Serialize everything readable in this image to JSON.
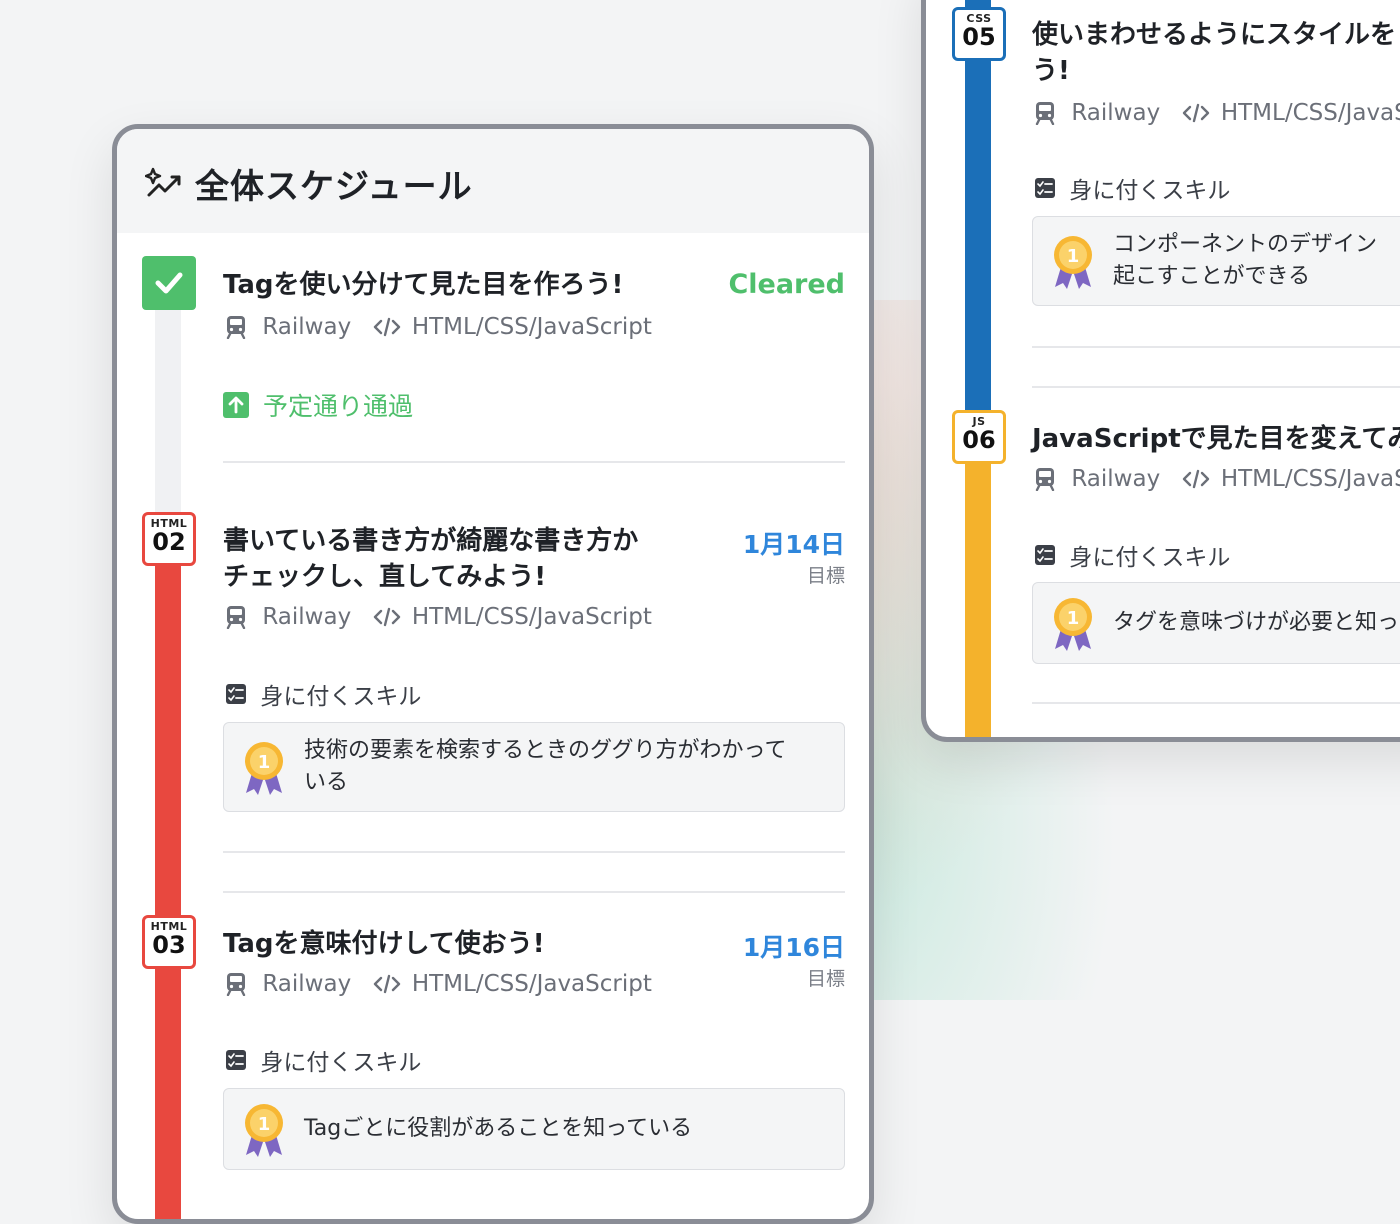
{
  "main": {
    "title": "全体スケジュール",
    "items": [
      {
        "title": "Tagを使い分けて見た目を作ろう!",
        "provider": "Railway",
        "tech": "HTML/CSS/JavaScript",
        "status": "Cleared",
        "passed": "予定通り通過"
      },
      {
        "category": "HTML",
        "number": "02",
        "title_line1": "書いている書き方が綺麗な書き方か",
        "title_line2": "チェックし、直してみよう!",
        "provider": "Railway",
        "tech": "HTML/CSS/JavaScript",
        "date": "1月14日",
        "date_label": "目標",
        "skills_label": "身に付くスキル",
        "skill_line1": "技術の要素を検索するときのググり方がわかって",
        "skill_line2": "いる"
      },
      {
        "category": "HTML",
        "number": "03",
        "title": "Tagを意味付けして使おう!",
        "provider": "Railway",
        "tech": "HTML/CSS/JavaScript",
        "date": "1月16日",
        "date_label": "目標",
        "skills_label": "身に付くスキル",
        "skill": "Tagごとに役割があることを知っている"
      }
    ]
  },
  "side": {
    "items": [
      {
        "category": "CSS",
        "number": "05",
        "title_line1": "使いまわせるようにスタイルを",
        "title_line2": "う!",
        "provider": "Railway",
        "tech": "HTML/CSS/JavaScr",
        "skills_label": "身に付くスキル",
        "skill_line1": "コンポーネントのデザイン",
        "skill_line2": "起こすことができる"
      },
      {
        "category": "JS",
        "number": "06",
        "title": "JavaScriptで見た目を変えてみ",
        "provider": "Railway",
        "tech": "HTML/CSS/JavaScr",
        "skills_label": "身に付くスキル",
        "skill": "タグを意味づけが必要と知っ"
      }
    ]
  },
  "colors": {
    "cleared": "#4fbf6c",
    "html": "#e8483f",
    "css": "#1b6fb8",
    "js": "#f4b22c",
    "date": "#2f86db"
  },
  "icons": [
    "sparkle-icon",
    "check-icon",
    "train-icon",
    "code-icon",
    "arrow-up-icon",
    "checklist-icon",
    "medal-icon"
  ]
}
